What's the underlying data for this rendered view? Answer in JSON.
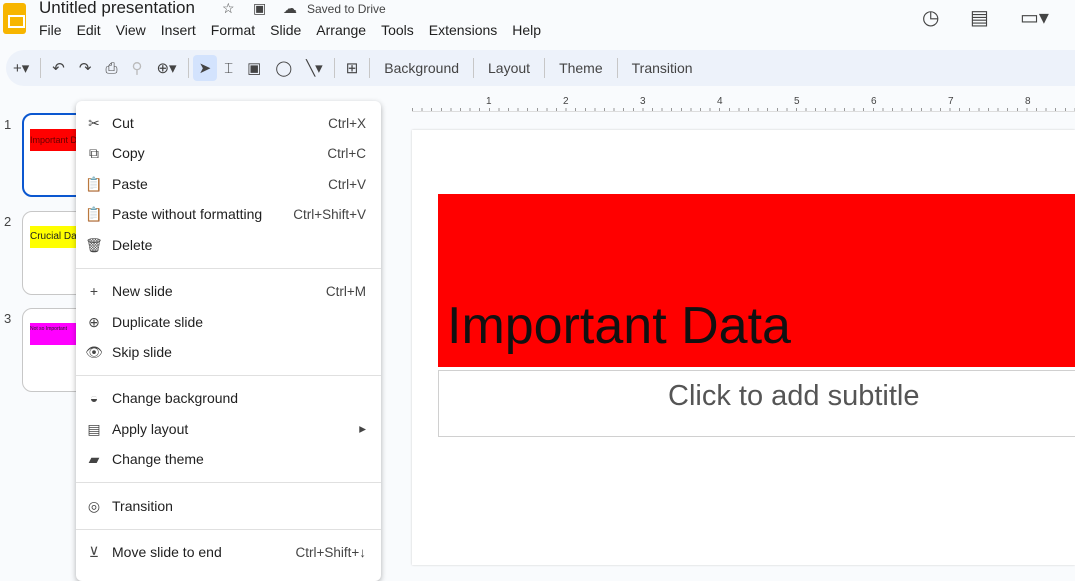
{
  "app": {
    "title": "Untitled presentation",
    "save_status": "Saved to Drive"
  },
  "menubar": [
    "File",
    "Edit",
    "View",
    "Insert",
    "Format",
    "Slide",
    "Arrange",
    "Tools",
    "Extensions",
    "Help"
  ],
  "toolbar": {
    "background": "Background",
    "layout": "Layout",
    "theme": "Theme",
    "transition": "Transition"
  },
  "slides": [
    {
      "number": "1",
      "title": "Important Data",
      "color": "#ff0000"
    },
    {
      "number": "2",
      "title": "Crucial Data",
      "color": "#ffff00"
    },
    {
      "number": "3",
      "title": "Not so Important",
      "color": "#ff00ff"
    }
  ],
  "ruler": [
    "1",
    "2",
    "3",
    "4",
    "5",
    "6",
    "7",
    "8"
  ],
  "canvas": {
    "title": "Important Data",
    "subtitle_placeholder": "Click to add subtitle",
    "title_bg": "#ff0000"
  },
  "context_menu": [
    {
      "icon": "scissors-icon",
      "glyph": "✂",
      "label": "Cut",
      "shortcut": "Ctrl+X"
    },
    {
      "icon": "copy-icon",
      "glyph": "⧉",
      "label": "Copy",
      "shortcut": "Ctrl+C"
    },
    {
      "icon": "clipboard-icon",
      "glyph": "📋",
      "label": "Paste",
      "shortcut": "Ctrl+V"
    },
    {
      "icon": "paste-plain-icon",
      "glyph": "📋",
      "label": "Paste without formatting",
      "shortcut": "Ctrl+Shift+V"
    },
    {
      "icon": "trash-icon",
      "glyph": "🗑",
      "label": "Delete",
      "shortcut": ""
    },
    {
      "icon": "plus-icon",
      "glyph": "+",
      "label": "New slide",
      "shortcut": "Ctrl+M"
    },
    {
      "icon": "duplicate-icon",
      "glyph": "⊕",
      "label": "Duplicate slide",
      "shortcut": ""
    },
    {
      "icon": "eye-icon",
      "glyph": "👁",
      "label": "Skip slide",
      "shortcut": ""
    },
    {
      "icon": "fill-icon",
      "glyph": "◒",
      "label": "Change background",
      "shortcut": ""
    },
    {
      "icon": "layout-icon",
      "glyph": "▤",
      "label": "Apply layout",
      "shortcut": "▸"
    },
    {
      "icon": "paint-roller-icon",
      "glyph": "▰",
      "label": "Change theme",
      "shortcut": ""
    },
    {
      "icon": "transition-icon",
      "glyph": "◎",
      "label": "Transition",
      "shortcut": ""
    },
    {
      "icon": "move-end-icon",
      "glyph": "⊻",
      "label": "Move slide to end",
      "shortcut": "Ctrl+Shift+↓"
    }
  ]
}
